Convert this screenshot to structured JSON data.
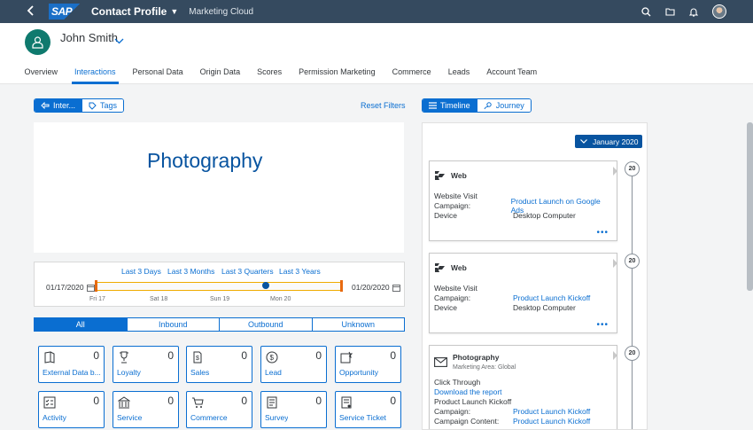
{
  "shell": {
    "logo": "SAP",
    "title": "Contact Profile",
    "subtitle": "Marketing Cloud"
  },
  "header": {
    "name": "John Smith",
    "tabs": [
      "Overview",
      "Interactions",
      "Personal Data",
      "Origin Data",
      "Scores",
      "Permission Marketing",
      "Commerce",
      "Leads",
      "Account Team"
    ],
    "active_tab": "Interactions"
  },
  "left": {
    "view_toggle": [
      "Inter...",
      "Tags"
    ],
    "reset_filters": "Reset Filters",
    "word_cloud": [
      "Photography"
    ],
    "quick_ranges": [
      "Last 3 Days",
      "Last 3 Months",
      "Last 3 Quarters",
      "Last 3 Years"
    ],
    "date_from": "01/17/2020",
    "date_to": "01/20/2020",
    "ticks": [
      "Fri 17",
      "Sat 18",
      "Sun 19",
      "Mon 20"
    ],
    "filters": [
      "All",
      "Inbound",
      "Outbound",
      "Unknown"
    ],
    "tiles": [
      {
        "label": "External Data b...",
        "count": "0",
        "icon": "book-icon"
      },
      {
        "label": "Loyalty",
        "count": "0",
        "icon": "trophy-icon"
      },
      {
        "label": "Sales",
        "count": "0",
        "icon": "document-dollar-icon"
      },
      {
        "label": "Lead",
        "count": "0",
        "icon": "dollar-circle-icon"
      },
      {
        "label": "Opportunity",
        "count": "0",
        "icon": "opportunity-icon"
      },
      {
        "label": "Activity",
        "count": "0",
        "icon": "activity-icon"
      },
      {
        "label": "Service",
        "count": "0",
        "icon": "building-icon"
      },
      {
        "label": "Commerce",
        "count": "0",
        "icon": "cart-icon"
      },
      {
        "label": "Survey",
        "count": "0",
        "icon": "survey-icon"
      },
      {
        "label": "Service Ticket",
        "count": "0",
        "icon": "ticket-icon"
      }
    ]
  },
  "right": {
    "view_toggle": [
      "Timeline",
      "Journey"
    ],
    "month": "January 2020",
    "cards": [
      {
        "day": "20",
        "channel": "Web",
        "type": "Website Visit",
        "rows": [
          {
            "k": "Campaign:",
            "v": "Product Launch on Google Ads",
            "link": true
          },
          {
            "k": "Device",
            "v": "Desktop Computer",
            "link": false
          }
        ]
      },
      {
        "day": "20",
        "channel": "Web",
        "type": "Website Visit",
        "rows": [
          {
            "k": "Campaign:",
            "v": "Product Launch Kickoff",
            "link": true
          },
          {
            "k": "Device",
            "v": "Desktop Computer",
            "link": false
          }
        ]
      },
      {
        "day": "20",
        "channel": "Photography",
        "channel_sub": "Marketing Area: Global",
        "type": "Click Through",
        "link_line": "Download the report",
        "plain_line": "Product Launch Kickoff",
        "rows": [
          {
            "k": "Campaign:",
            "v": "Product Launch Kickoff",
            "link": true
          },
          {
            "k": "Campaign Content:",
            "v": "Product Launch Kickoff",
            "link": true
          }
        ]
      }
    ],
    "more": "•••"
  }
}
